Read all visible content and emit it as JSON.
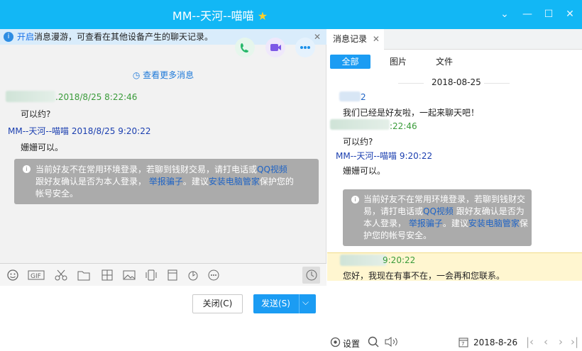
{
  "title": {
    "name": "MM--天河--喵喵",
    "star": "★"
  },
  "window": {
    "minimize": "⌄",
    "min": "—",
    "max": "☐",
    "close": "✕"
  },
  "notice": {
    "highlight": "开启",
    "text": "消息漫游，可查看在其他设备产生的聊天记录。",
    "close": "✕"
  },
  "chat": {
    "more": "查看更多消息",
    "messages": [
      {
        "sender": "",
        "time": ".2018/8/25 8:22:46",
        "text": "可以约?"
      },
      {
        "sender": "MM--天河--喵喵",
        "time": "2018/8/25 9:20:22",
        "text": "姗姗可以。"
      }
    ],
    "warning": {
      "l1a": "当前好友不在常用环境登录，若聊到钱财交易，请打电话或",
      "qq": "QQ视频",
      "l2a": "跟好友确认是否为本人登录，",
      "report": "举报骗子",
      "l2b": "。建议",
      "install": "安装电脑管家",
      "l2c": "保护您的",
      "l3": "帐号安全。"
    }
  },
  "buttons": {
    "close": "关闭(C)",
    "send": "发送(S)",
    "send_arrow": "⌵"
  },
  "history": {
    "tab": "消息记录",
    "tab_close": "✕",
    "filters": [
      "全部",
      "图片",
      "文件"
    ],
    "date": "2018-08-25",
    "items": [
      {
        "meta": "2",
        "text": "我们已经是好友啦，一起来聊天吧！"
      },
      {
        "meta": ":22:46",
        "text": "可以约?"
      },
      {
        "meta": "MM--天河--喵喵 9:20:22",
        "text": "姗姗可以。"
      }
    ],
    "warning": {
      "l1": "当前好友不在常用环境登录，若聊到钱财交",
      "l2a": "易，请打电话或",
      "qq": "QQ视频",
      "l2b": "跟好友确认是否为",
      "l3a": "本人登录，",
      "report": "举报骗子",
      "l3b": "。建议",
      "install": "安装电脑管家",
      "l3c": "保",
      "l4": "护您的帐号安全。"
    },
    "auto": {
      "meta": "9:20:22",
      "text": "您好，我现在有事不在，一会再和您联系。"
    },
    "bottom": {
      "settings": "设置",
      "date": "2018-8-26"
    }
  },
  "colors": {
    "titlebar": "#12b7f5",
    "accent": "#1b9cf3",
    "warn": "#ababab"
  }
}
